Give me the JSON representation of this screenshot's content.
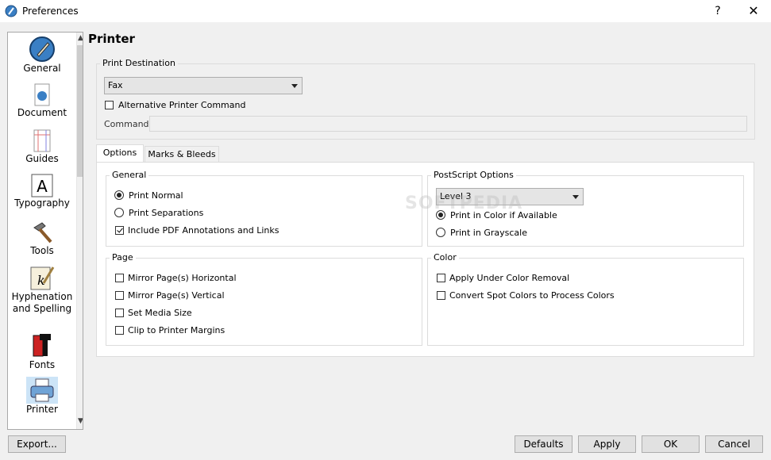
{
  "window": {
    "title": "Preferences",
    "help_label": "?",
    "close_label": "✕"
  },
  "sidebar": {
    "items": [
      {
        "label": "General",
        "icon": "pen-nib-icon"
      },
      {
        "label": "Document",
        "icon": "document-icon"
      },
      {
        "label": "Guides",
        "icon": "guides-icon"
      },
      {
        "label": "Typography",
        "icon": "letter-a-icon"
      },
      {
        "label": "Tools",
        "icon": "hammer-icon"
      },
      {
        "label": "Hyphenation\nand Spelling",
        "icon": "quill-icon"
      },
      {
        "label": "Fonts",
        "icon": "fonts-icon"
      },
      {
        "label": "Printer",
        "icon": "printer-icon",
        "selected": true
      }
    ]
  },
  "page": {
    "title": "Printer"
  },
  "print_destination": {
    "legend": "Print Destination",
    "selected": "Fax",
    "alt_command_label": "Alternative Printer Command",
    "alt_command_checked": false,
    "command_label": "Command:",
    "command_value": ""
  },
  "tabs": [
    {
      "label": "Options",
      "active": true
    },
    {
      "label": "Marks & Bleeds",
      "active": false
    }
  ],
  "general": {
    "legend": "General",
    "print_normal": "Print Normal",
    "print_separations": "Print Separations",
    "include_pdf": "Include PDF Annotations and Links"
  },
  "postscript": {
    "legend": "PostScript Options",
    "level": "Level 3",
    "color_label": "Print in Color if Available",
    "grayscale_label": "Print in Grayscale"
  },
  "page_group": {
    "legend": "Page",
    "mirror_h": "Mirror Page(s) Horizontal",
    "mirror_v": "Mirror Page(s) Vertical",
    "media_size": "Set Media Size",
    "clip": "Clip to Printer Margins"
  },
  "color_group": {
    "legend": "Color",
    "ucr": "Apply Under Color Removal",
    "spot": "Convert Spot Colors to Process Colors"
  },
  "buttons": {
    "export": "Export...",
    "defaults": "Defaults",
    "apply": "Apply",
    "ok": "OK",
    "cancel": "Cancel"
  },
  "watermark": "SOFTPEDIA",
  "colors": {
    "selection": "#cce4f7",
    "accent": "#3a7fc4"
  }
}
